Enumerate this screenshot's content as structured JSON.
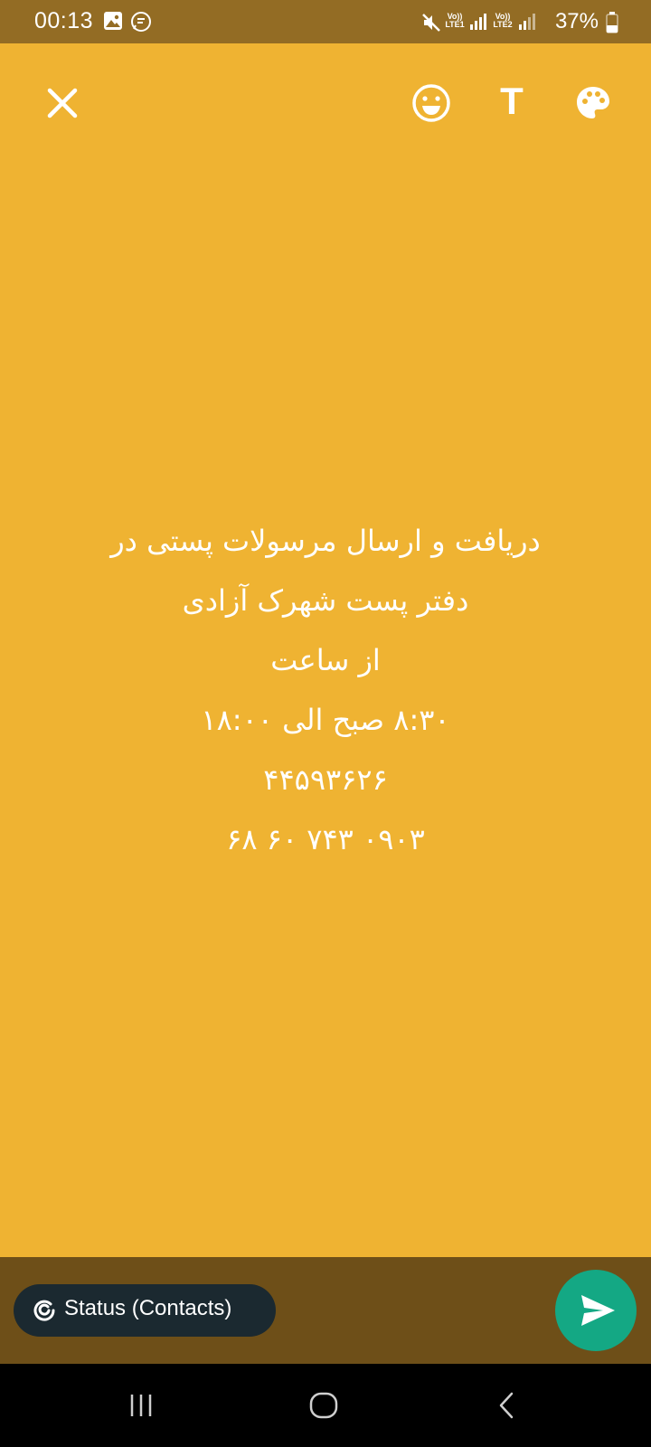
{
  "status_bar": {
    "time": "00:13",
    "sim1_label": "Vo))",
    "sim1_net": "LTE1",
    "sim2_label": "Vo))",
    "sim2_net": "LTE2",
    "battery": "37%",
    "icons": [
      "gallery-notification-icon",
      "message-notification-icon",
      "mute-icon",
      "signal-icon",
      "battery-icon"
    ]
  },
  "toolbar": {
    "icons": [
      "close-icon",
      "emoji-icon",
      "text-icon",
      "palette-icon"
    ],
    "text_button_label": "T"
  },
  "caption": {
    "lines": [
      "دریافت و ارسال مرسولات پستی در",
      "دفتر پست شهرک آزادی",
      "از ساعت",
      "۸:۳۰ صبح الی ۱۸:۰۰",
      "۴۴۵۹۳۶۲۶",
      "۰۹۰۳ ۷۴۳ ۶۰ ۶۸"
    ]
  },
  "bottom": {
    "audience_label": "Status (Contacts)",
    "send_icon": "send-icon"
  },
  "nav": {
    "icons": [
      "recent-apps-icon",
      "home-icon",
      "back-icon"
    ]
  },
  "colors": {
    "background": "#efb332",
    "status_bar": "#936c24",
    "bottom_bar": "#6e4f18",
    "pill": "#1b2930",
    "send": "#14a884"
  }
}
